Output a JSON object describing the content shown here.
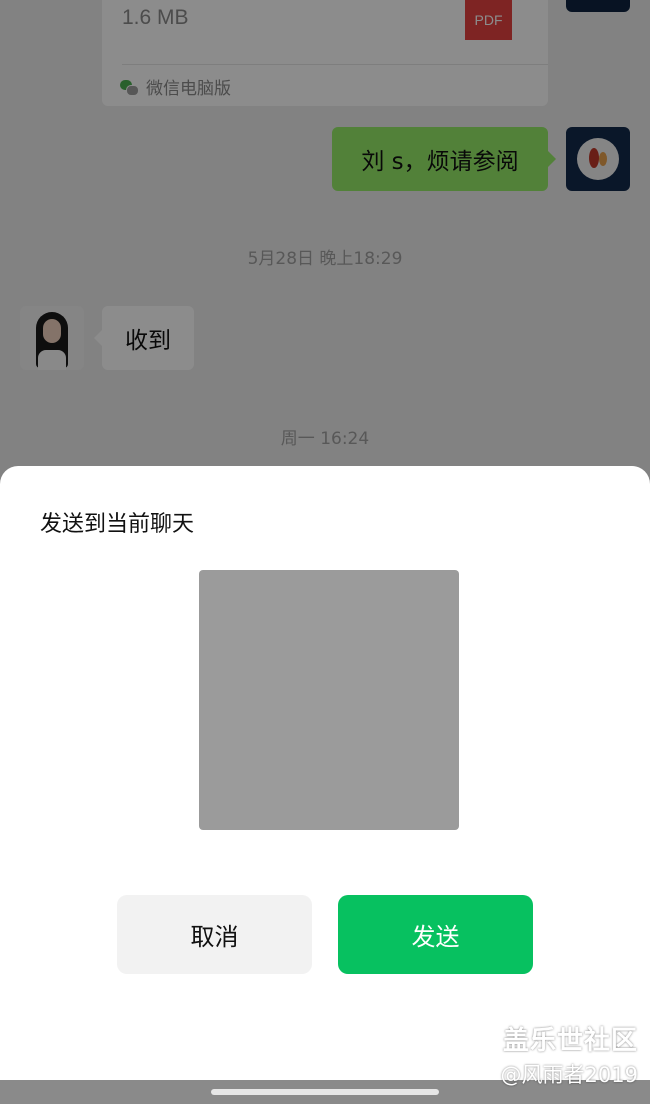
{
  "chat": {
    "file_card": {
      "size": "1.6 MB",
      "file_type": "PDF",
      "source": "微信电脑版"
    },
    "outgoing_message": "刘 s，烦请参阅",
    "timestamp_1": "5月28日 晚上18:29",
    "incoming_message": "收到",
    "timestamp_2": "周一 16:24"
  },
  "sheet": {
    "title": "发送到当前聊天",
    "cancel_label": "取消",
    "send_label": "发送"
  },
  "watermark": {
    "line1": "盖乐世社区",
    "line2": "@风雨者2019"
  },
  "colors": {
    "send_button": "#07c160",
    "outgoing_bubble": "#95ec69",
    "pdf_icon": "#e64340"
  }
}
